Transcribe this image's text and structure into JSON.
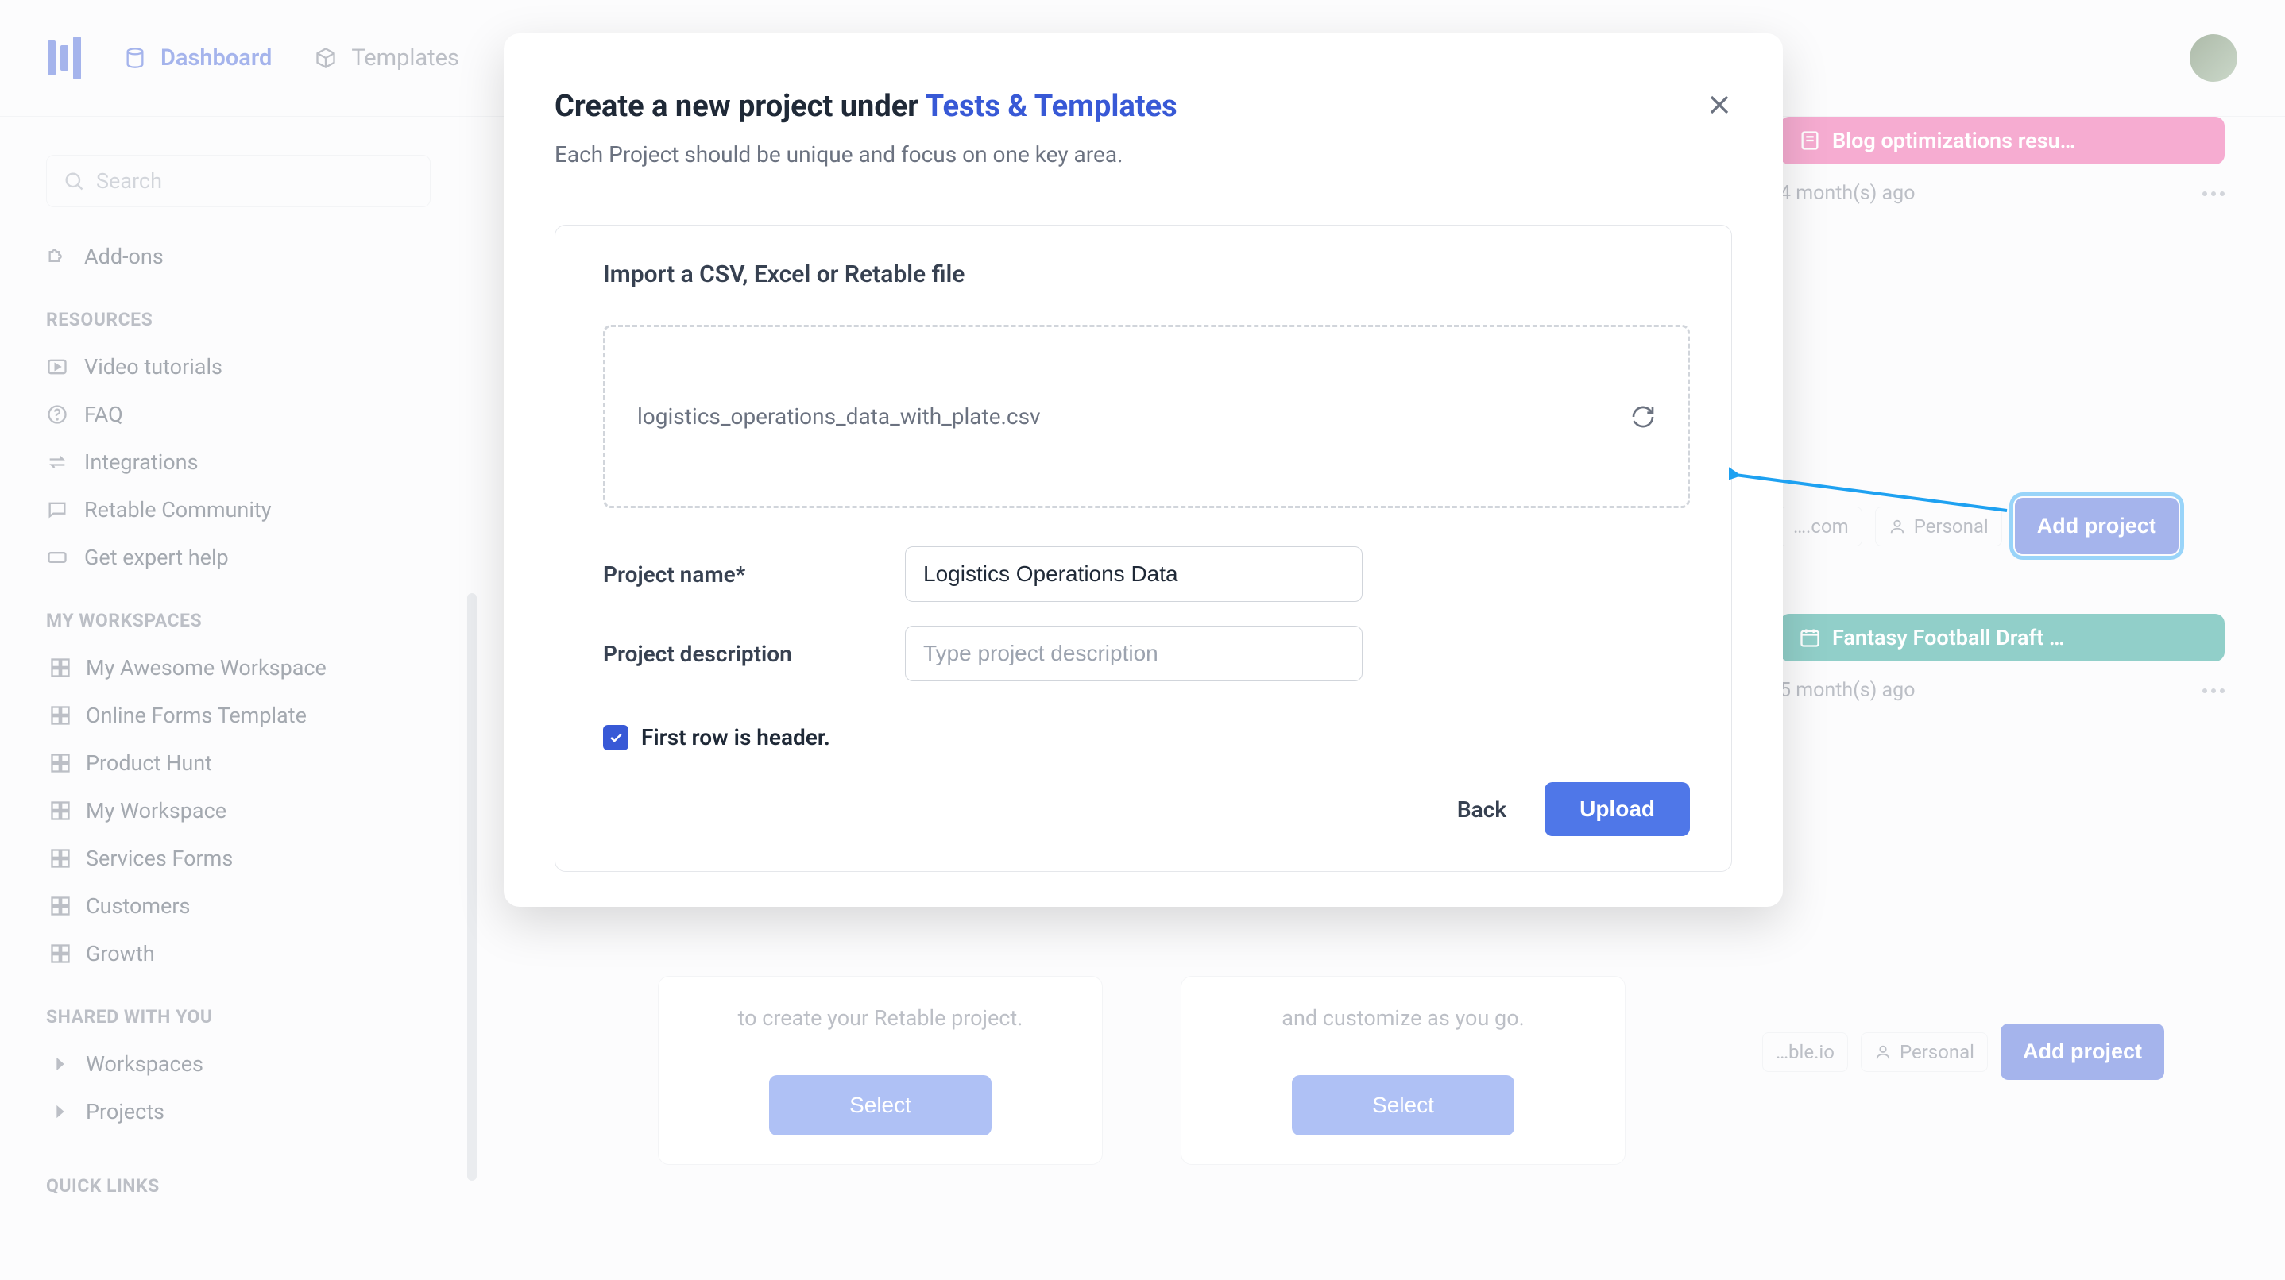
{
  "nav": {
    "dashboard": "Dashboard",
    "templates": "Templates"
  },
  "sidebar": {
    "search_placeholder": "Search",
    "addons": "Add-ons",
    "resources_heading": "RESOURCES",
    "resources": [
      "Video tutorials",
      "FAQ",
      "Integrations",
      "Retable Community",
      "Get expert help"
    ],
    "my_workspaces_heading": "MY WORKSPACES",
    "workspaces": [
      "My Awesome Workspace",
      "Online Forms Template",
      "Product Hunt",
      "My Workspace",
      "Services Forms",
      "Customers",
      "Growth"
    ],
    "shared_heading": "SHARED WITH YOU",
    "shared": [
      "Workspaces",
      "Projects"
    ],
    "quicklinks_heading": "QUICK LINKS"
  },
  "main": {
    "pink_pill": "Blog optimizations resu…",
    "pink_time": "4 month(s) ago",
    "teal_pill": "Fantasy Football Draft …",
    "teal_time": "5 month(s) ago",
    "domain_tag": "…ble.io",
    "personal_tag": "Personal",
    "addproject": "Add project",
    "dotcom_tag": "….com",
    "select": "Select",
    "desc1": "to create your Retable project.",
    "desc2": "and customize as you go."
  },
  "modal": {
    "title_prefix": "Create a new project under ",
    "title_highlight": "Tests & Templates",
    "subtitle": "Each Project should be unique and focus on one key area.",
    "import_label": "Import a CSV, Excel or Retable file",
    "filename": "logistics_operations_data_with_plate.csv",
    "name_label": "Project name*",
    "name_value": "Logistics Operations Data",
    "desc_label": "Project description",
    "desc_placeholder": "Type project description",
    "checkbox_label": "First row is header.",
    "back": "Back",
    "upload": "Upload"
  }
}
